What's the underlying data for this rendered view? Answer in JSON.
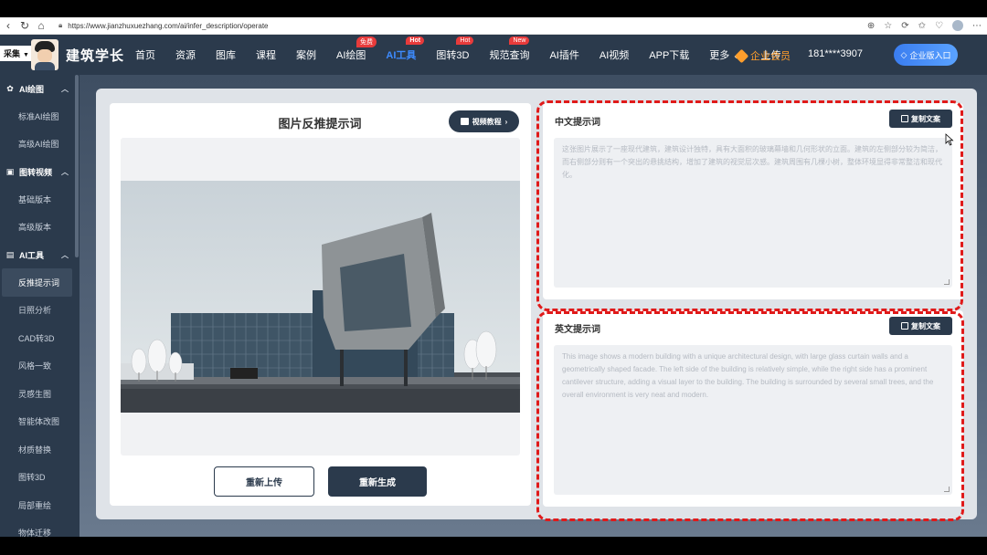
{
  "browser": {
    "url": "https://www.jianzhuxuezhang.com/ai/infer_description/operate"
  },
  "header": {
    "collect_label": "采集",
    "brand": "建筑学长",
    "nav": [
      {
        "label": "首页",
        "badge": ""
      },
      {
        "label": "资源",
        "badge": ""
      },
      {
        "label": "图库",
        "badge": ""
      },
      {
        "label": "课程",
        "badge": ""
      },
      {
        "label": "案例",
        "badge": ""
      },
      {
        "label": "AI绘图",
        "badge": "免费"
      },
      {
        "label": "AI工具",
        "badge": "Hot"
      },
      {
        "label": "图转3D",
        "badge": "Hot"
      },
      {
        "label": "规范查询",
        "badge": "New"
      },
      {
        "label": "AI插件",
        "badge": ""
      },
      {
        "label": "AI视频",
        "badge": ""
      },
      {
        "label": "APP下载",
        "badge": ""
      },
      {
        "label": "更多",
        "badge": ""
      },
      {
        "label": "上传",
        "badge": ""
      }
    ],
    "active_nav": "AI工具",
    "vip_label": "企业会员",
    "phone": "181****3907",
    "enterprise_button": "企业版入口",
    "colors": {
      "bg": "#2b3a4c",
      "active": "#3d8bff",
      "vip": "#ff9e2c",
      "badge": "#e83b3b"
    }
  },
  "sidebar": {
    "groups": [
      {
        "label": "AI绘图",
        "icon": "palette-icon",
        "items": [
          "标准AI绘图",
          "高级AI绘图"
        ]
      },
      {
        "label": "图转视频",
        "icon": "video-icon",
        "items": [
          "基础版本",
          "高级版本"
        ]
      },
      {
        "label": "AI工具",
        "icon": "toolbox-icon",
        "items": [
          "反推提示词",
          "日照分析",
          "CAD转3D",
          "风格一致",
          "灵感生图",
          "智能体改图",
          "材质替换",
          "图转3D",
          "局部重绘",
          "物体迁移"
        ]
      }
    ],
    "active_item": "反推提示词"
  },
  "left_panel": {
    "title": "图片反推提示词",
    "video_button": "视频教程",
    "reupload_button": "重新上传",
    "regenerate_button": "重新生成"
  },
  "zh_panel": {
    "title": "中文提示词",
    "copy_button": "复制文案",
    "text": "这张图片展示了一座现代建筑，建筑设计独特，具有大面积的玻璃幕墙和几何形状的立面。建筑的左侧部分较为简洁，而右侧部分则有一个突出的悬挑结构，增加了建筑的视觉层次感。建筑周围有几棵小树，整体环境显得非常整洁和现代化。"
  },
  "en_panel": {
    "title": "英文提示词",
    "copy_button": "复制文案",
    "text": "This image shows a modern building with a unique architectural design, with large glass curtain walls and a geometrically shaped facade. The left side of the building is relatively simple, while the right side has a prominent cantilever structure, adding a visual layer to the building. The building is surrounded by several small trees, and the overall environment is very neat and modern."
  }
}
